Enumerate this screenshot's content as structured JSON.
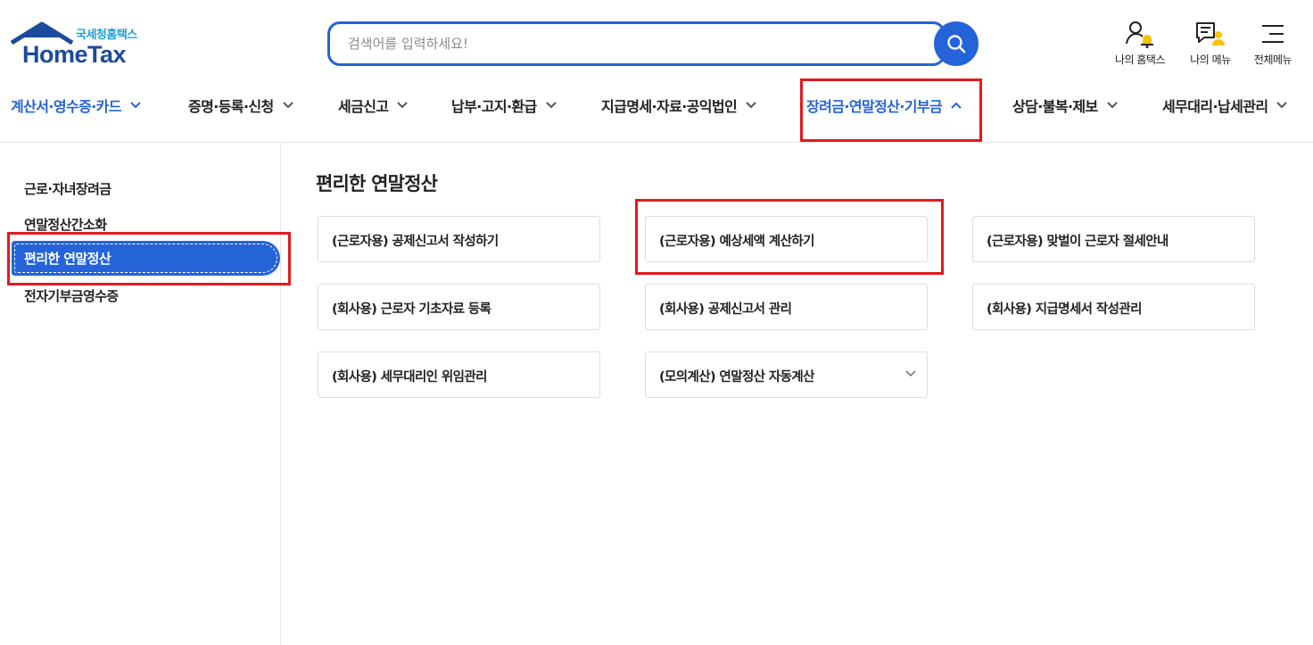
{
  "logo": {
    "korean": "국세청홈택스",
    "english": "HomeTax"
  },
  "search": {
    "placeholder": "검색어를 입력하세요!"
  },
  "utility": [
    {
      "label": "나의 홈택스",
      "icon": "my-hometax-icon"
    },
    {
      "label": "나의 메뉴",
      "icon": "my-menu-icon"
    },
    {
      "label": "전체메뉴",
      "icon": "hamburger-menu-icon"
    }
  ],
  "gnb": [
    {
      "label": "계산서·영수증·카드",
      "expanded": false,
      "color": "blue"
    },
    {
      "label": "증명·등록·신청",
      "expanded": false
    },
    {
      "label": "세금신고",
      "expanded": false
    },
    {
      "label": "납부·고지·환급",
      "expanded": false
    },
    {
      "label": "지급명세·자료·공익법인",
      "expanded": false
    },
    {
      "label": "장려금·연말정산·기부금",
      "expanded": true,
      "color": "blue"
    },
    {
      "label": "상담·불복·제보",
      "expanded": false
    },
    {
      "label": "세무대리·납세관리",
      "expanded": false
    }
  ],
  "sidebar": {
    "items": [
      {
        "label": "근로·자녀장려금"
      },
      {
        "label": "연말정산간소화"
      },
      {
        "label": "편리한 연말정산",
        "active": true
      },
      {
        "label": "전자기부금영수증"
      }
    ]
  },
  "main": {
    "title": "편리한 연말정산",
    "cards": [
      {
        "label": "(근로자용) 공제신고서 작성하기"
      },
      {
        "label": "(근로자용) 예상세액 계산하기"
      },
      {
        "label": "(근로자용) 맞벌이 근로자 절세안내"
      },
      {
        "label": "(회사용) 근로자 기초자료 등록"
      },
      {
        "label": "(회사용) 공제신고서 관리"
      },
      {
        "label": "(회사용) 지급명세서 작성관리"
      },
      {
        "label": "(회사용) 세무대리인 위임관리"
      },
      {
        "label": "(모의계산) 연말정산 자동계산",
        "has_dropdown": true
      }
    ]
  },
  "colors": {
    "accent": "#2563d9",
    "logo_navy": "#1c4a9c",
    "logo_cyan": "#1b9fd4",
    "highlight": "#e3191d",
    "bell": "#f5c400"
  }
}
